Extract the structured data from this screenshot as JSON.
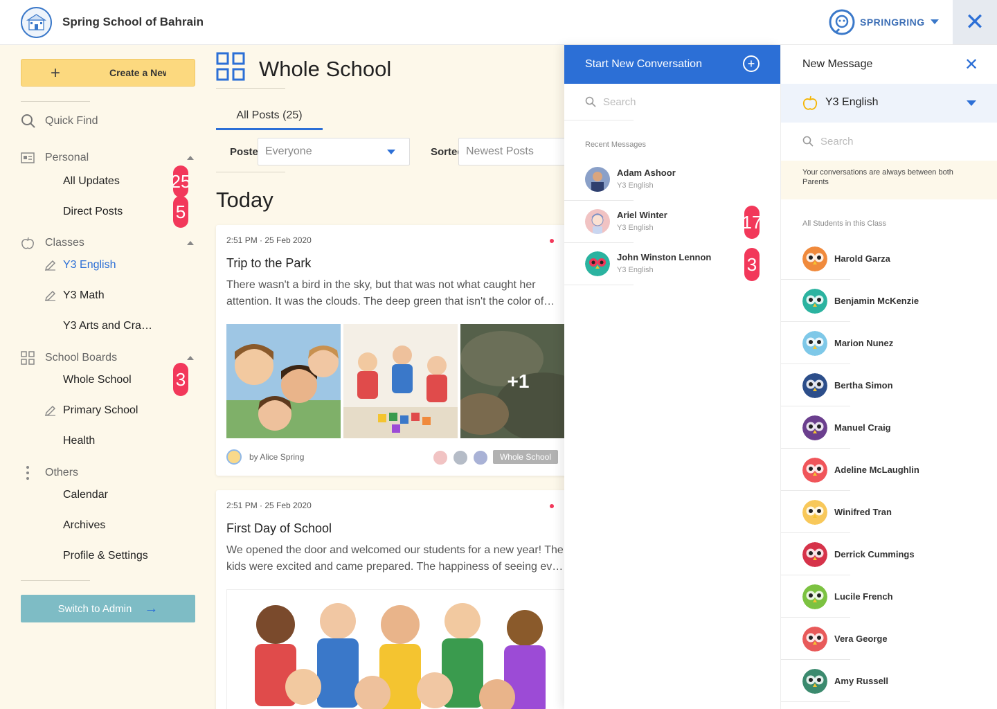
{
  "header": {
    "school_name": "Spring School of Bahrain",
    "brand_name": "SPRINGRING"
  },
  "sidebar": {
    "create_label": "Create a New",
    "quick_find": "Quick Find",
    "personal": {
      "label": "Personal",
      "items": [
        {
          "label": "All Updates",
          "badge": "25"
        },
        {
          "label": "Direct Posts",
          "badge": "5"
        }
      ]
    },
    "classes": {
      "label": "Classes",
      "items": [
        {
          "label": "Y3 English"
        },
        {
          "label": "Y3 Math"
        },
        {
          "label": "Y3 Arts and Cra…"
        }
      ]
    },
    "boards": {
      "label": "School Boards",
      "items": [
        {
          "label": "Whole School",
          "badge": "3"
        },
        {
          "label": "Primary School"
        },
        {
          "label": "Health"
        }
      ]
    },
    "others": {
      "label": "Others",
      "items": [
        {
          "label": "Calendar"
        },
        {
          "label": "Archives"
        },
        {
          "label": "Profile & Settings"
        }
      ]
    },
    "admin_label": "Switch to Admin"
  },
  "main": {
    "title": "Whole School",
    "tab_all": "All Posts (25)",
    "posted_to_label": "Posted To",
    "posted_to_value": "Everyone",
    "sorted_by_label": "Sorted By",
    "sorted_by_value": "Newest Posts",
    "today": "Today",
    "posts": [
      {
        "time": "2:51 PM · 25 Feb 2020",
        "title": "Trip to the Park",
        "body": "There wasn't a bird in the sky, but that was not what caught her attention. It was the clouds. The deep green that isn't the color of…",
        "more_photos": "+1",
        "author": "by Alice Spring",
        "tag": "Whole School"
      },
      {
        "time": "2:51 PM · 25 Feb 2020",
        "title": "First Day of School",
        "body": "We opened the door and welcomed our students for a new year! The kids were excited and came prepared. The happiness of seeing ev…"
      }
    ]
  },
  "conversation": {
    "title": "Start New Conversation",
    "search_placeholder": "Search",
    "recent_label": "Recent Messages",
    "items": [
      {
        "name": "Adam Ashoor",
        "sub": "Y3 English"
      },
      {
        "name": "Ariel Winter",
        "sub": "Y3 English",
        "badge": "17"
      },
      {
        "name": "John Winston Lennon",
        "sub": "Y3 English",
        "badge": "3"
      }
    ]
  },
  "new_message": {
    "title": "New Message",
    "class_selected": "Y3 English",
    "search_placeholder": "Search",
    "notice": "Your conversations are always between both Parents",
    "all_label": "All Students in this Class",
    "students": [
      {
        "name": "Harold Garza",
        "color": "#f08a3c"
      },
      {
        "name": "Benjamin McKenzie",
        "color": "#2bb3a0"
      },
      {
        "name": "Marion Nunez",
        "color": "#7ec8e8"
      },
      {
        "name": "Bertha Simon",
        "color": "#2c4e8a"
      },
      {
        "name": "Manuel Craig",
        "color": "#6b3f8e"
      },
      {
        "name": "Adeline McLaughlin",
        "color": "#f0555a"
      },
      {
        "name": "Winifred Tran",
        "color": "#f8c85a"
      },
      {
        "name": "Derrick Cummings",
        "color": "#d6334a"
      },
      {
        "name": "Lucile French",
        "color": "#7cc241"
      },
      {
        "name": "Vera George",
        "color": "#e85a5a"
      },
      {
        "name": "Amy Russell",
        "color": "#3b8a6e"
      }
    ]
  },
  "colors": {
    "accent": "#2c6fd6",
    "badge": "#f2385a",
    "cream": "#fdf8ea",
    "create": "#fcd97f",
    "admin": "#7ebcc5"
  }
}
